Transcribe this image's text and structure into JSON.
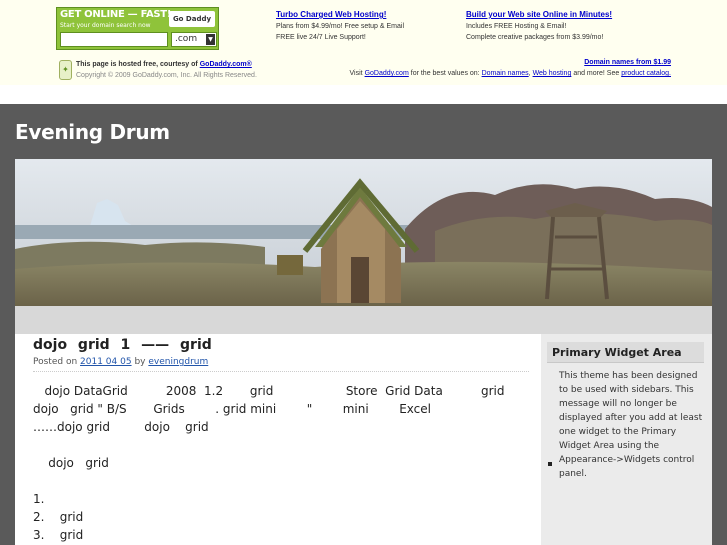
{
  "ad": {
    "headline": "GET ONLINE — FAST!",
    "sub": "Start your domain search now",
    "logo": "Go Daddy",
    "tld": ".com",
    "col1": {
      "link": "Turbo Charged Web Hosting!",
      "line1": "Plans from $4.99/mo! Free setup & Email",
      "line2": "FREE live 24/7 Live Support!"
    },
    "col2": {
      "link": "Build your Web site Online in Minutes!",
      "line1": "Includes FREE Hosting & Email!",
      "line2": "Complete creative packages from $3.99/mo!"
    },
    "hosted_text": "This page is hosted free, courtesy of",
    "hosted_link": "GoDaddy.com®",
    "copyright": "Copyright © 2009 GoDaddy.com, Inc. All Rights Reserved.",
    "domains_link": "Domain names from $1.99",
    "visit_prefix": "Visit",
    "visit_link": "GoDaddy.com",
    "visit_mid": "for the best values on:",
    "visit_domain": "Domain names",
    "visit_hosting": "Web hosting",
    "visit_more": "and more! See",
    "visit_catalog": "product catalog."
  },
  "site": {
    "title": "Evening Drum"
  },
  "post": {
    "title": "dojo grid 1 —— grid",
    "meta_prefix": "Posted on",
    "date": "2011 04 05",
    "meta_by": "by",
    "author": "eveningdrum",
    "para1": "   dojo DataGrid          2008  1.2       grid                   Store  Grid Data          grid      dojo   grid \" B/S       Grids        . grid mini        \"        mini        Excel                                     ……dojo grid         dojo    grid",
    "para2": "    dojo   grid",
    "list": [
      "1.",
      "2.    grid",
      "3.    grid"
    ]
  },
  "sidebar": {
    "widget_title": "Primary Widget Area",
    "widget_text": "This theme has been designed to be used with sidebars. This message will no longer be displayed after you add at least one widget to the Primary Widget Area using the Appearance->Widgets control panel."
  }
}
